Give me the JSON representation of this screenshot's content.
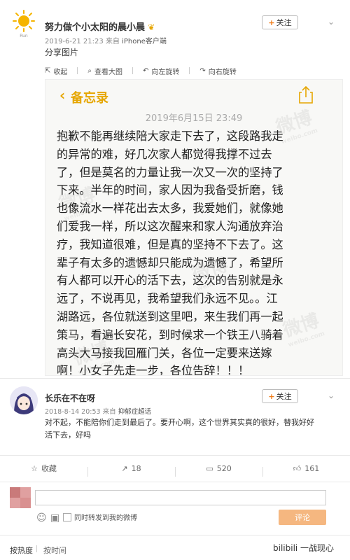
{
  "post": {
    "author": "努力做个小太阳的晨小晨",
    "meta_time": "2019-6-21 21:23",
    "meta_from": "来自",
    "meta_device": "iPhone客户端",
    "text": "分享图片",
    "follow_label": "关注",
    "toolbar": [
      "收起",
      "查看大图",
      "向左旋转",
      "向右旋转"
    ]
  },
  "memo": {
    "back_label": "备忘录",
    "date": "2019年6月15日 23:49",
    "lines": [
      "抱歉不能再继续陪大家走下去了，这段路我走",
      "的异常的难，好几次家人都觉得我撑不过去",
      "了，但是莫名的力量让我一次又一次的坚持了",
      "下来。半年的时间，家人因为我备受折磨，钱",
      "也像流水一样花出去太多，我爱她们，就像她",
      "们爱我一样，所以这次醒来和家人沟通放弃治",
      "疗，我知道很难，但是真的坚持不下去了。这",
      "辈子有太多的遗憾却只能成为遗憾了，希望所",
      "有人都可以开心的活下去，这次的告别就是永",
      "远了，不说再见，我希望我们永远不见。。江",
      "湖路远，各位就送到这里吧，来生我们再一起",
      "策马，看遍长安花，到时候求一个铁王八骑着",
      "高头大马接我回雁门关，各位一定要来送嫁",
      "啊！小女子先走一步，各位告辞！！！"
    ],
    "watermark": "微博",
    "watermark_sub": "weibo.com"
  },
  "comment": {
    "name": "长乐在不在呀",
    "follow_label": "关注",
    "meta_time": "2018-8-14 20:53",
    "meta_from": "来自",
    "meta_source": "抑郁症超话",
    "text_line1": "对不起，不能陪你们走到最后了。要开心啊，这个世界其实真的很好，替我好好",
    "text_line2": "活下去，好吗"
  },
  "actions": {
    "collect": "收藏",
    "forward": "18",
    "comment": "520",
    "like": "161"
  },
  "reply": {
    "forward_label": "同时转发到我的微博",
    "submit_label": "评论"
  },
  "sort": {
    "hot": "按热度",
    "time": "按时间",
    "bili": "bilibili 一战现心"
  },
  "colors": {
    "memo_accent": "#e6a600",
    "follow_plus": "#f07a15",
    "submit_bg": "#f5b780"
  }
}
